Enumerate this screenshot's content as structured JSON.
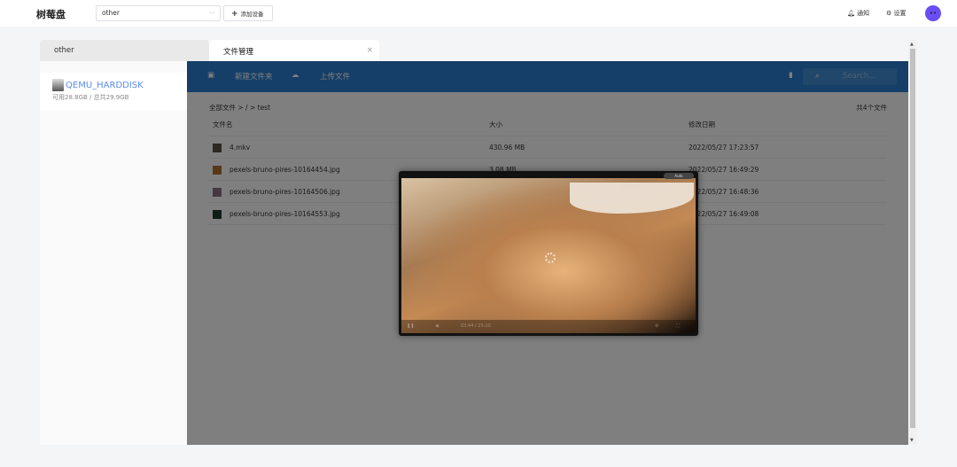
{
  "app": {
    "title": "树莓盘"
  },
  "header": {
    "device_select": "other",
    "add_device": "添加设备",
    "notify": "通知",
    "settings": "设置"
  },
  "tabs": [
    {
      "label": "other"
    },
    {
      "label": "文件管理"
    }
  ],
  "disk": {
    "name": "QEMU_HARDDISK",
    "usage": "可用28.8GB / 总共29.9GB"
  },
  "toolbar": {
    "new_folder": "新建文件夹",
    "upload": "上传文件",
    "search_placeholder": "Search..."
  },
  "breadcrumb": "全部文件 > / > test",
  "file_count": "共4个文件",
  "table": {
    "headers": [
      "文件名",
      "大小",
      "修改日期"
    ],
    "rows": [
      {
        "name": "4.mkv",
        "size": "430.96 MB",
        "date": "2022/05/27 17:23:57",
        "thumb": "#5a5040"
      },
      {
        "name": "pexels-bruno-pires-10164454.jpg",
        "size": "3.08 MB",
        "date": "2022/05/27 16:49:29",
        "thumb": "#b07030"
      },
      {
        "name": "pexels-bruno-pires-10164506.jpg",
        "size": "",
        "date": "2022/05/27 16:48:36",
        "thumb": "#8a7080"
      },
      {
        "name": "pexels-bruno-pires-10164553.jpg",
        "size": "",
        "date": "2022/05/27 16:49:08",
        "thumb": "#1f3a2a"
      }
    ]
  },
  "video": {
    "quality": "Auto",
    "time": "03:44 / 25:20"
  },
  "colors": {
    "toolbar": "#2a7fd0",
    "disk_name": "#5b8def",
    "avatar": "#6a4df5"
  }
}
